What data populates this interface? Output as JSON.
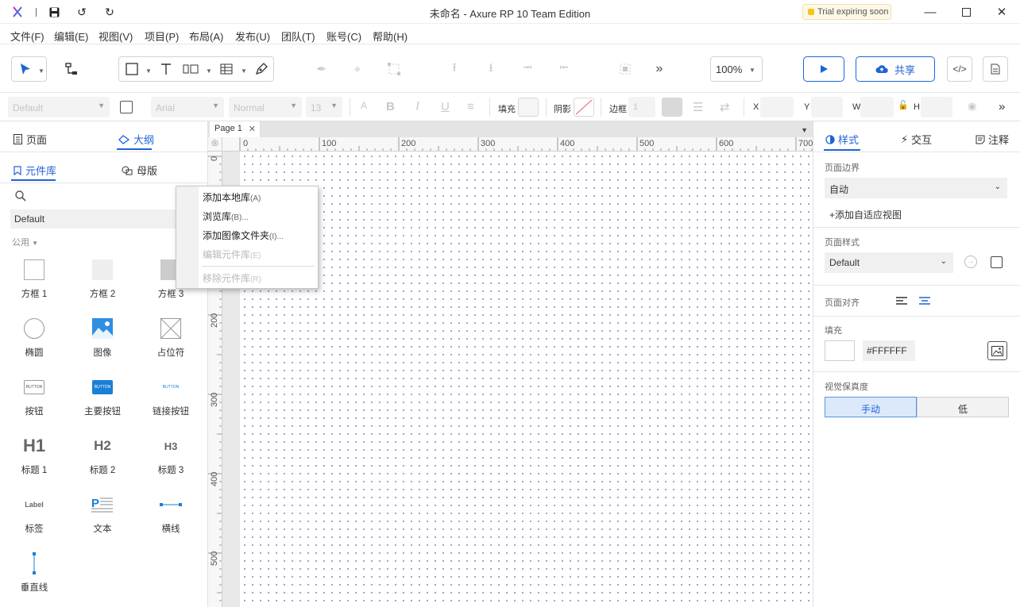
{
  "titlebar": {
    "title": "未命名 - Axure RP 10 Team Edition",
    "trial": "Trial expiring soon"
  },
  "menu": [
    "文件(F)",
    "编辑(E)",
    "视图(V)",
    "项目(P)",
    "布局(A)",
    "发布(U)",
    "团队(T)",
    "账号(C)",
    "帮助(H)"
  ],
  "toolbar": {
    "zoom": "100%",
    "share": "共享"
  },
  "format": {
    "style": "Default",
    "font": "Arial",
    "weight": "Normal",
    "size": "13",
    "fill_label": "填充",
    "shadow_label": "阴影",
    "border_label": "边框",
    "border_value": "1",
    "x_label": "X",
    "y_label": "Y",
    "w_label": "W",
    "h_label": "H"
  },
  "left": {
    "tab_pages": "页面",
    "tab_outline": "大纲",
    "tab_library": "元件库",
    "tab_masters": "母版",
    "library": "Default",
    "group": "公用",
    "widgets": [
      "方框 1",
      "方框 2",
      "方框 3",
      "椭圆",
      "图像",
      "占位符",
      "按钮",
      "主要按钮",
      "链接按钮",
      "标题 1",
      "标题 2",
      "标题 3",
      "标签",
      "文本",
      "横线",
      "垂直线"
    ],
    "button_text": "BUTTON",
    "h1": "H1",
    "h2": "H2",
    "h3": "H3",
    "label_text": "Label"
  },
  "context_menu": [
    {
      "label": "添加本地库",
      "shortcut": "(A)",
      "enabled": true
    },
    {
      "label": "浏览库",
      "shortcut": "(B)...",
      "enabled": true
    },
    {
      "label": "添加图像文件夹",
      "shortcut": "(I)...",
      "enabled": true
    },
    {
      "label": "编辑元件库",
      "shortcut": "(E)",
      "enabled": false
    },
    {
      "label": "移除元件库",
      "shortcut": "(R)",
      "enabled": false
    }
  ],
  "canvas": {
    "page_tab": "Page 1",
    "h_marks": [
      "0",
      "100",
      "200",
      "300",
      "400",
      "500",
      "600",
      "700"
    ],
    "v_marks": [
      "0",
      "100",
      "200",
      "300",
      "400",
      "500"
    ]
  },
  "right": {
    "tab_style": "样式",
    "tab_interact": "交互",
    "tab_notes": "注释",
    "page_bounds_label": "页面边界",
    "page_bounds": "自动",
    "add_view": "添加自适应视图",
    "page_style_label": "页面样式",
    "page_style": "Default",
    "align_label": "页面对齐",
    "fill_label": "填充",
    "fill_hex": "#FFFFFF",
    "fidelity_label": "视觉保真度",
    "fidelity_manual": "手动",
    "fidelity_low": "低"
  },
  "colors": {
    "accent": "#1f63d8",
    "trial_bg": "#fdf8e6"
  }
}
